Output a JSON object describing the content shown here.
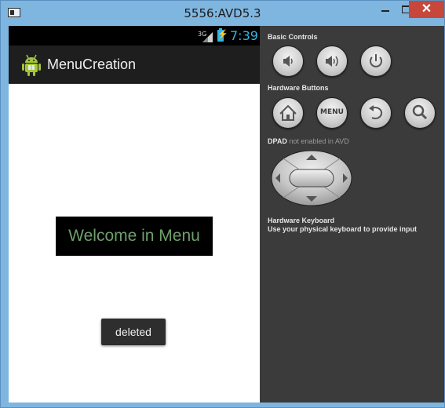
{
  "window": {
    "title": "5556:AVD5.3",
    "close_glyph": "✕"
  },
  "statusbar": {
    "network": "3G",
    "time": "7:39"
  },
  "app": {
    "title": "MenuCreation",
    "welcome_text": "Welcome in Menu",
    "toast_text": "deleted"
  },
  "controls": {
    "basic_controls_label": "Basic Controls",
    "hardware_buttons_label": "Hardware Buttons",
    "dpad_label": "DPAD",
    "dpad_status": "not enabled in AVD",
    "hardware_keyboard_label": "Hardware Keyboard",
    "hardware_keyboard_hint": "Use your physical keyboard to provide input",
    "menu_button_label": "MENU"
  },
  "colors": {
    "accent": "#33b5e5",
    "close_red": "#c7473a",
    "welcome_green": "#6f9f6a"
  },
  "icons": [
    "window-icon",
    "minimize-icon",
    "maximize-icon",
    "close-icon",
    "signal-icon",
    "battery-icon",
    "android-icon",
    "volume-down-icon",
    "volume-up-icon",
    "power-icon",
    "home-icon",
    "back-icon",
    "search-icon",
    "dpad-icon"
  ]
}
